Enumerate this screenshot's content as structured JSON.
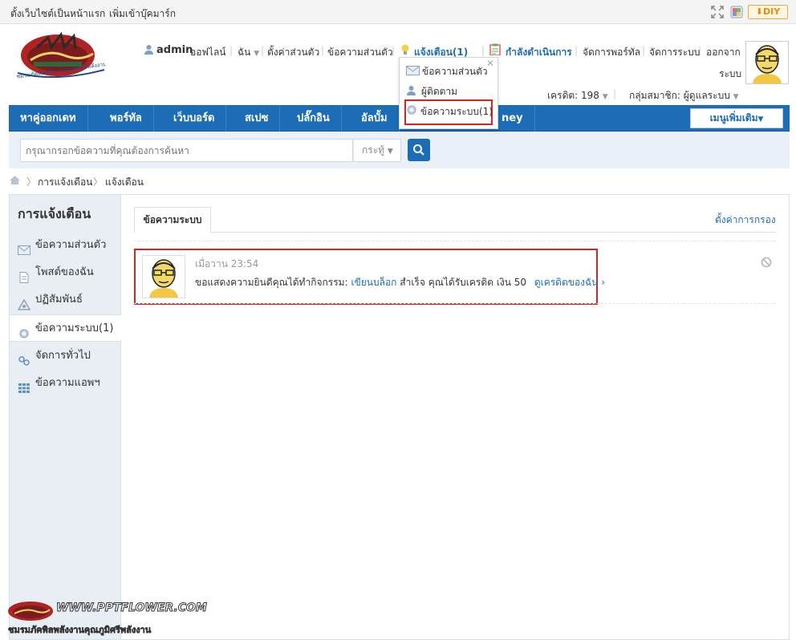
{
  "topbar": {
    "set_homepage": "ตั้งเว็บไซต์เป็นหน้าแรก",
    "add_bookmark": "เพิ่มเข้าบุ๊คมาร์ก",
    "diy_label": "DIY"
  },
  "logo": {
    "alt_text": "ชมรมภัคพิลพลังงานคุณภูมิศรีพลังงาน"
  },
  "header": {
    "username": "admin",
    "online_status": "ออฟไลน์",
    "me_menu": "ฉัน",
    "settings": "ตั้งค่าส่วนตัว",
    "private_messages": "ข้อความส่วนตัว",
    "notifications": "แจ้งเตือน(1)",
    "in_progress": "กำลังดำเนินการ",
    "manage_portal": "จัดการพอร์ทัล",
    "manage_system": "จัดการระบบ",
    "logout_1": "ออกจาก",
    "logout_2": "ระบบ",
    "credits": "เครดิต: 198",
    "group": "กลุ่มสมาชิก: ผู้ดูแลระบบ"
  },
  "notif_dropdown": {
    "items": [
      {
        "label": "ข้อความส่วนตัว"
      },
      {
        "label": "ผู้ติดตาม"
      },
      {
        "label": "ข้อความระบบ(1)"
      }
    ]
  },
  "mainnav": {
    "items": [
      {
        "label": "หาคู่ออกเดท"
      },
      {
        "label": "พอร์ทัล"
      },
      {
        "label": "เว็บบอร์ด"
      },
      {
        "label": "สเปซ"
      },
      {
        "label": "ปลั๊กอิน"
      },
      {
        "label": "อัลบั้ม"
      },
      {
        "label": "ney"
      }
    ],
    "more_menu": "เมนูเพิ่มเติม"
  },
  "search": {
    "placeholder": "กรุณากรอกข้อความที่คุณต้องการค้นหา",
    "type_label": "กระทู้"
  },
  "breadcrumb": {
    "level1": "การแจ้งเตือน",
    "level2": "แจ้งเตือน"
  },
  "sidebar": {
    "title": "การแจ้งเตือน",
    "items": [
      {
        "label": "ข้อความส่วนตัว"
      },
      {
        "label": "โพสต์ของฉัน"
      },
      {
        "label": "ปฏิสัมพันธ์"
      },
      {
        "label": "ข้อความระบบ(1)"
      },
      {
        "label": "จัดการทั่วไป"
      },
      {
        "label": "ข้อความแอพฯ"
      }
    ]
  },
  "main": {
    "tab_label": "ข้อความระบบ",
    "filter_settings": "ตั้งค่าการกรอง",
    "notice": {
      "time": "เมื่อวาน 23:54",
      "text_before": "ขอแสดงความยินดีคุณได้ทำกิจกรรม:",
      "activity_link": "เขียนบล็อก",
      "text_after": "สำเร็จ คุณได้รับเครดิต เงิน 50",
      "credit_link": "ดูเครดิตของฉัน ›"
    }
  },
  "watermark": {
    "url": "WWW.PPTFLOWER.COM",
    "subtitle": "ชมรมภัคพิลพลังงานคุณภูมิศรีพลังงาน"
  },
  "colors": {
    "nav_blue": "#1c6db5",
    "link_blue": "#1c6db5",
    "highlight_red": "#d9231f",
    "diy_orange": "#f08a00"
  }
}
